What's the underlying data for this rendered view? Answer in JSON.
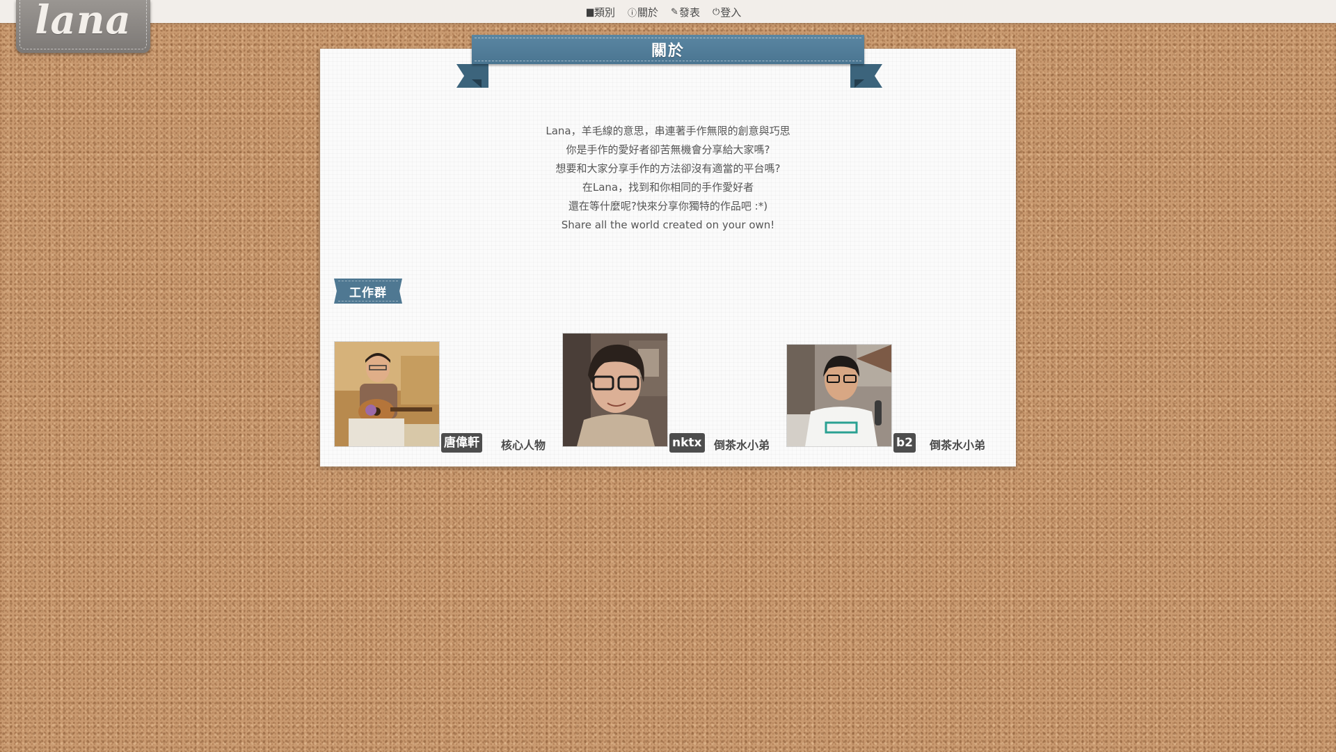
{
  "brand": {
    "logo_text": "lana"
  },
  "nav": [
    {
      "icon": "folder-icon",
      "glyph": "▆",
      "label": "類別"
    },
    {
      "icon": "info-icon",
      "glyph": "ⓘ",
      "label": "關於"
    },
    {
      "icon": "pencil-icon",
      "glyph": "✎",
      "label": "發表"
    },
    {
      "icon": "power-icon",
      "glyph": "⏻",
      "label": "登入"
    }
  ],
  "page": {
    "title": "關於",
    "intro": [
      "Lana，羊毛線的意思，串連著手作無限的創意與巧思",
      "你是手作的愛好者卻苦無機會分享給大家嗎?",
      "想要和大家分享手作的方法卻沒有適當的平台嗎?",
      "在Lana，找到和你相同的手作愛好者",
      "還在等什麼呢?快來分享你獨特的作品吧 :*)",
      "Share all the world created on your own!"
    ],
    "team_label": "工作群"
  },
  "team": [
    {
      "name": "唐偉軒",
      "role": "核心人物"
    },
    {
      "name": "nktx",
      "role": "倒茶水小弟"
    },
    {
      "name": "b2",
      "role": "倒茶水小弟"
    }
  ],
  "colors": {
    "cork": "#c99a70",
    "ribbon": "#4a7591",
    "name_tag": "#4d4d4d"
  }
}
